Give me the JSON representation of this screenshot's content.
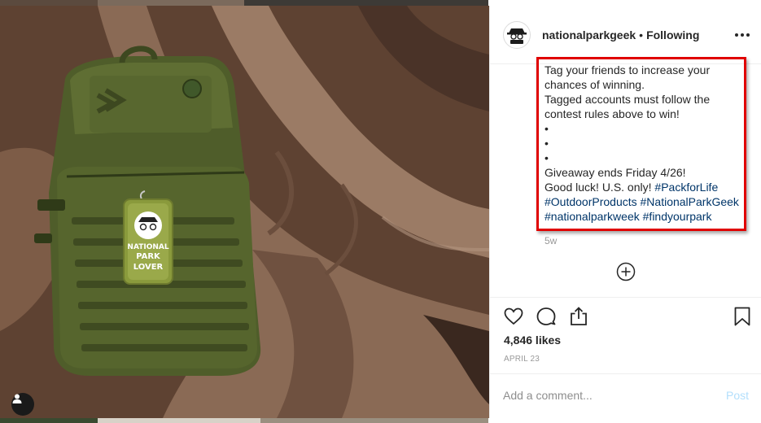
{
  "post": {
    "username": "nationalparkgeek",
    "separator": "•",
    "follow_status": "Following",
    "avatar_name": "national-park-geek-logo",
    "caption_lines": [
      "Tag your friends to increase your",
      "chances of winning.",
      "Tagged accounts must follow the",
      "contest rules above to win!",
      "•",
      "•",
      "•",
      "Giveaway ends Friday 4/26!"
    ],
    "caption_last_prefix": "Good luck! U.S. only! ",
    "hashtags": [
      "#PackforLife",
      "#OutdoorProducts",
      "#NationalParkGeek",
      "#nationalparkweek",
      "#findyourpark"
    ],
    "time_ago": "5w",
    "likes": "4,846 likes",
    "date": "APRIL 23"
  },
  "photo": {
    "tag_text": [
      "NATIONAL PARK",
      "GEEK",
      "NATIONAL",
      "PARK",
      "LOVER"
    ]
  },
  "comment": {
    "placeholder": "Add a comment...",
    "post_label": "Post"
  },
  "colors": {
    "hashtag": "#003569",
    "highlight": "#e00000",
    "muted": "#999999"
  }
}
